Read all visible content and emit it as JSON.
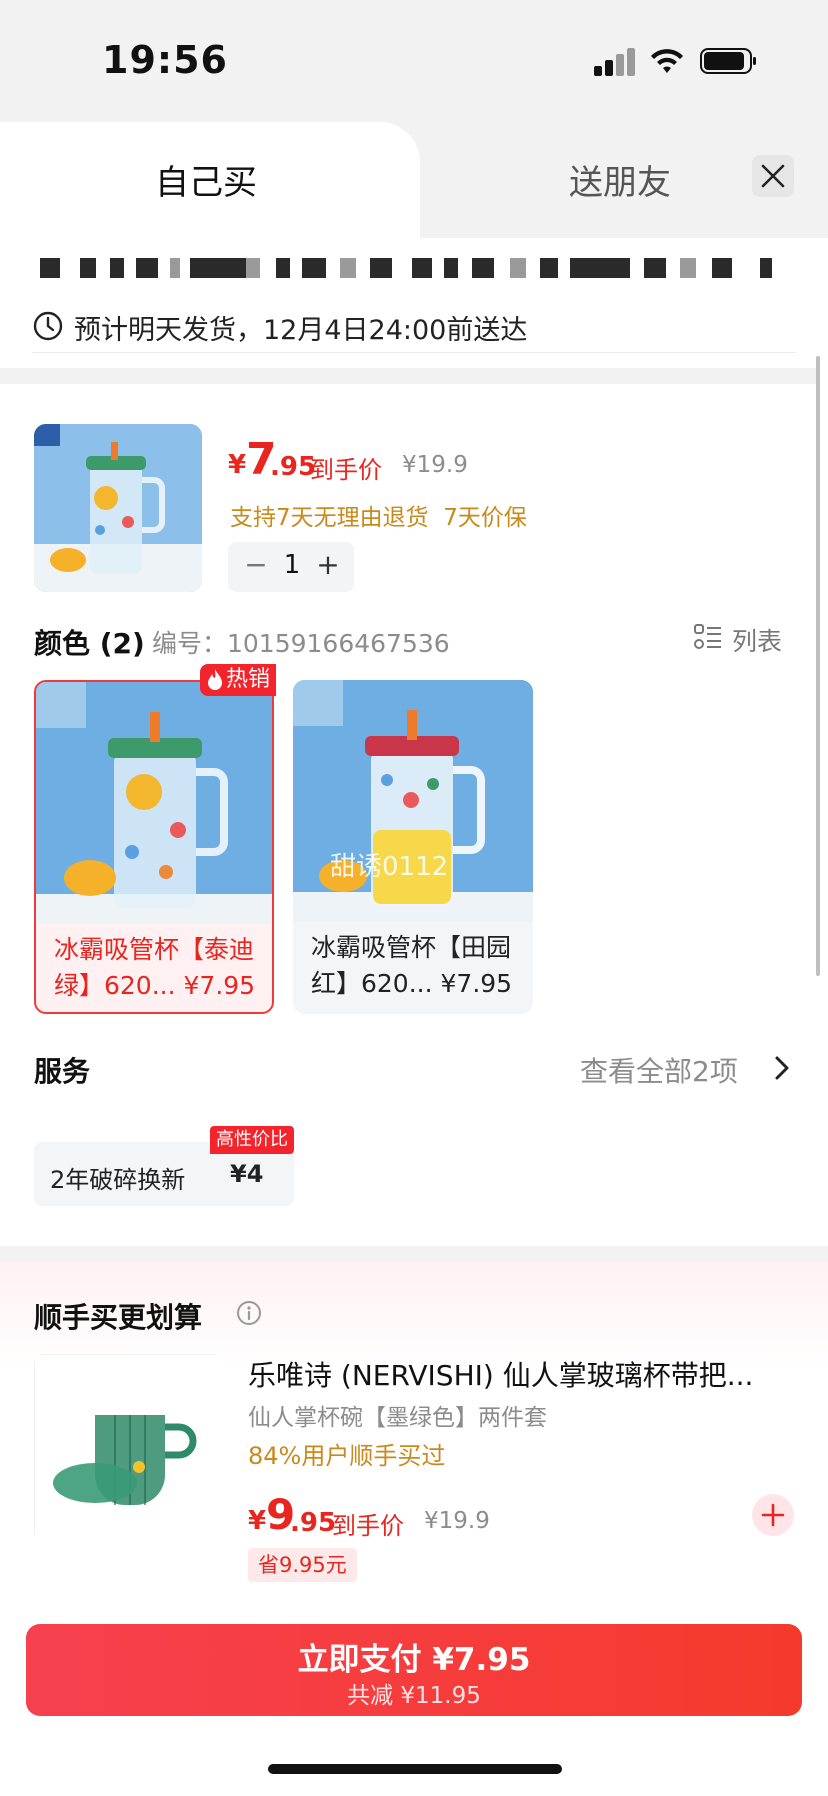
{
  "status_bar": {
    "time": "19:56"
  },
  "tabs": [
    {
      "label": "自己买",
      "active": true
    },
    {
      "label": "送朋友",
      "active": false
    }
  ],
  "delivery": {
    "text": "预计明天发货，12月4日24:00前送达"
  },
  "product": {
    "price_symbol": "¥",
    "price_int": "7",
    "price_dec": ".95",
    "price_label": "到手价",
    "original_price": "¥19.9",
    "service_tags": "支持7天无理由退货  7天价保",
    "quantity": "1",
    "minus": "−",
    "plus": "+"
  },
  "color_section": {
    "title": "颜色 (2)",
    "sku": "编号：10159166467536",
    "list_label": "列表"
  },
  "variants": [
    {
      "name": "冰霸吸管杯【泰迪绿】620... ¥7.95",
      "badge": "热销",
      "selected": true
    },
    {
      "name": "冰霸吸管杯【田园红】620... ¥7.95",
      "selected": false
    }
  ],
  "watermark": "甜诱0112",
  "services": {
    "title": "服务",
    "more": "查看全部2项",
    "items": [
      {
        "badge": "高性价比",
        "name": "2年破碎换新",
        "price": "¥4"
      }
    ]
  },
  "upsell": {
    "title": "顺手买更划算",
    "product_name": "乐唯诗 (NERVISHI) 仙人掌玻璃杯带把...",
    "spec": "仙人掌杯碗【墨绿色】两件套",
    "social": "84%用户顺手买过",
    "price_symbol": "¥",
    "price_int": "9",
    "price_dec": ".95",
    "price_label": "到手价",
    "original_price": "¥19.9",
    "save": "省9.95元"
  },
  "pay": {
    "main": "立即支付 ¥7.95",
    "sub": "共减 ¥11.95"
  },
  "colors": {
    "accent": "#e8261f",
    "gold": "#c98a1c",
    "hot": "#f3242c"
  }
}
